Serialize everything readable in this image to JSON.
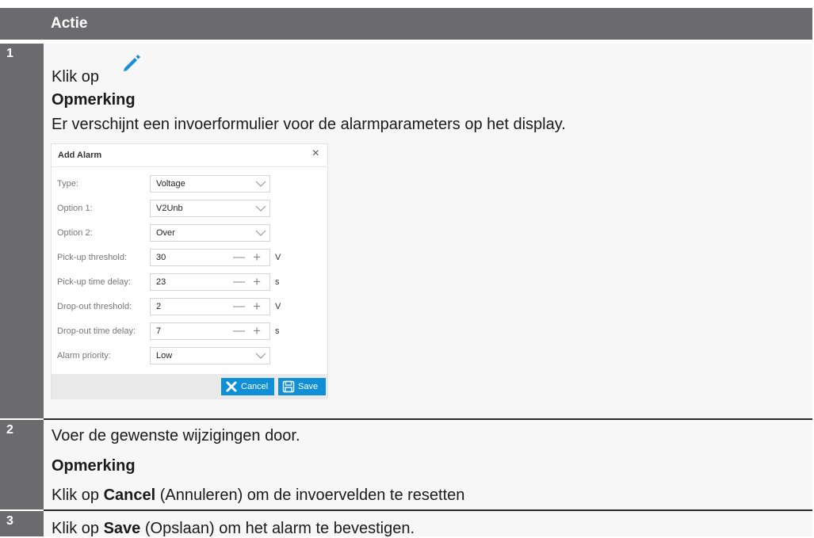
{
  "header": {
    "title": "Actie"
  },
  "steps": [
    {
      "number": "1",
      "click_prefix": "Klik op",
      "icon": "pencil-icon",
      "note_heading": "Opmerking",
      "note_text": "Er verschijnt een invoerformulier voor de alarmparameters op het display."
    },
    {
      "number": "2",
      "text": "Voer de gewenste wijzigingen door.",
      "note_heading": "Opmerking",
      "note_prefix": "Klik op ",
      "note_bold": "Cancel",
      "note_suffix": " (Annuleren) om de invoervelden te resetten"
    },
    {
      "number": "3",
      "prefix": "Klik op ",
      "bold": "Save",
      "suffix": " (Opslaan) om het alarm te bevestigen."
    }
  ],
  "dialog": {
    "title": "Add Alarm",
    "close_glyph": "×",
    "fields": [
      {
        "label": "Type:",
        "value": "Voltage",
        "kind": "select"
      },
      {
        "label": "Option 1:",
        "value": "V2Unb",
        "kind": "select"
      },
      {
        "label": "Option 2:",
        "value": "Over",
        "kind": "select"
      },
      {
        "label": "Pick-up threshold:",
        "value": "30",
        "kind": "stepper",
        "unit": "V"
      },
      {
        "label": "Pick-up time delay:",
        "value": "23",
        "kind": "stepper",
        "unit": "s"
      },
      {
        "label": "Drop-out threshold:",
        "value": "2",
        "kind": "stepper",
        "unit": "V"
      },
      {
        "label": "Drop-out time delay:",
        "value": "7",
        "kind": "stepper",
        "unit": "s"
      },
      {
        "label": "Alarm priority:",
        "value": "Low",
        "kind": "select"
      }
    ],
    "stepper_minus": "—",
    "stepper_plus": "+",
    "cancel_label": "Cancel",
    "save_label": "Save"
  },
  "colors": {
    "header_gray": "#6b6b6d",
    "accent_blue": "#0e8fd6",
    "pencil_blue": "#1a8fd8"
  }
}
